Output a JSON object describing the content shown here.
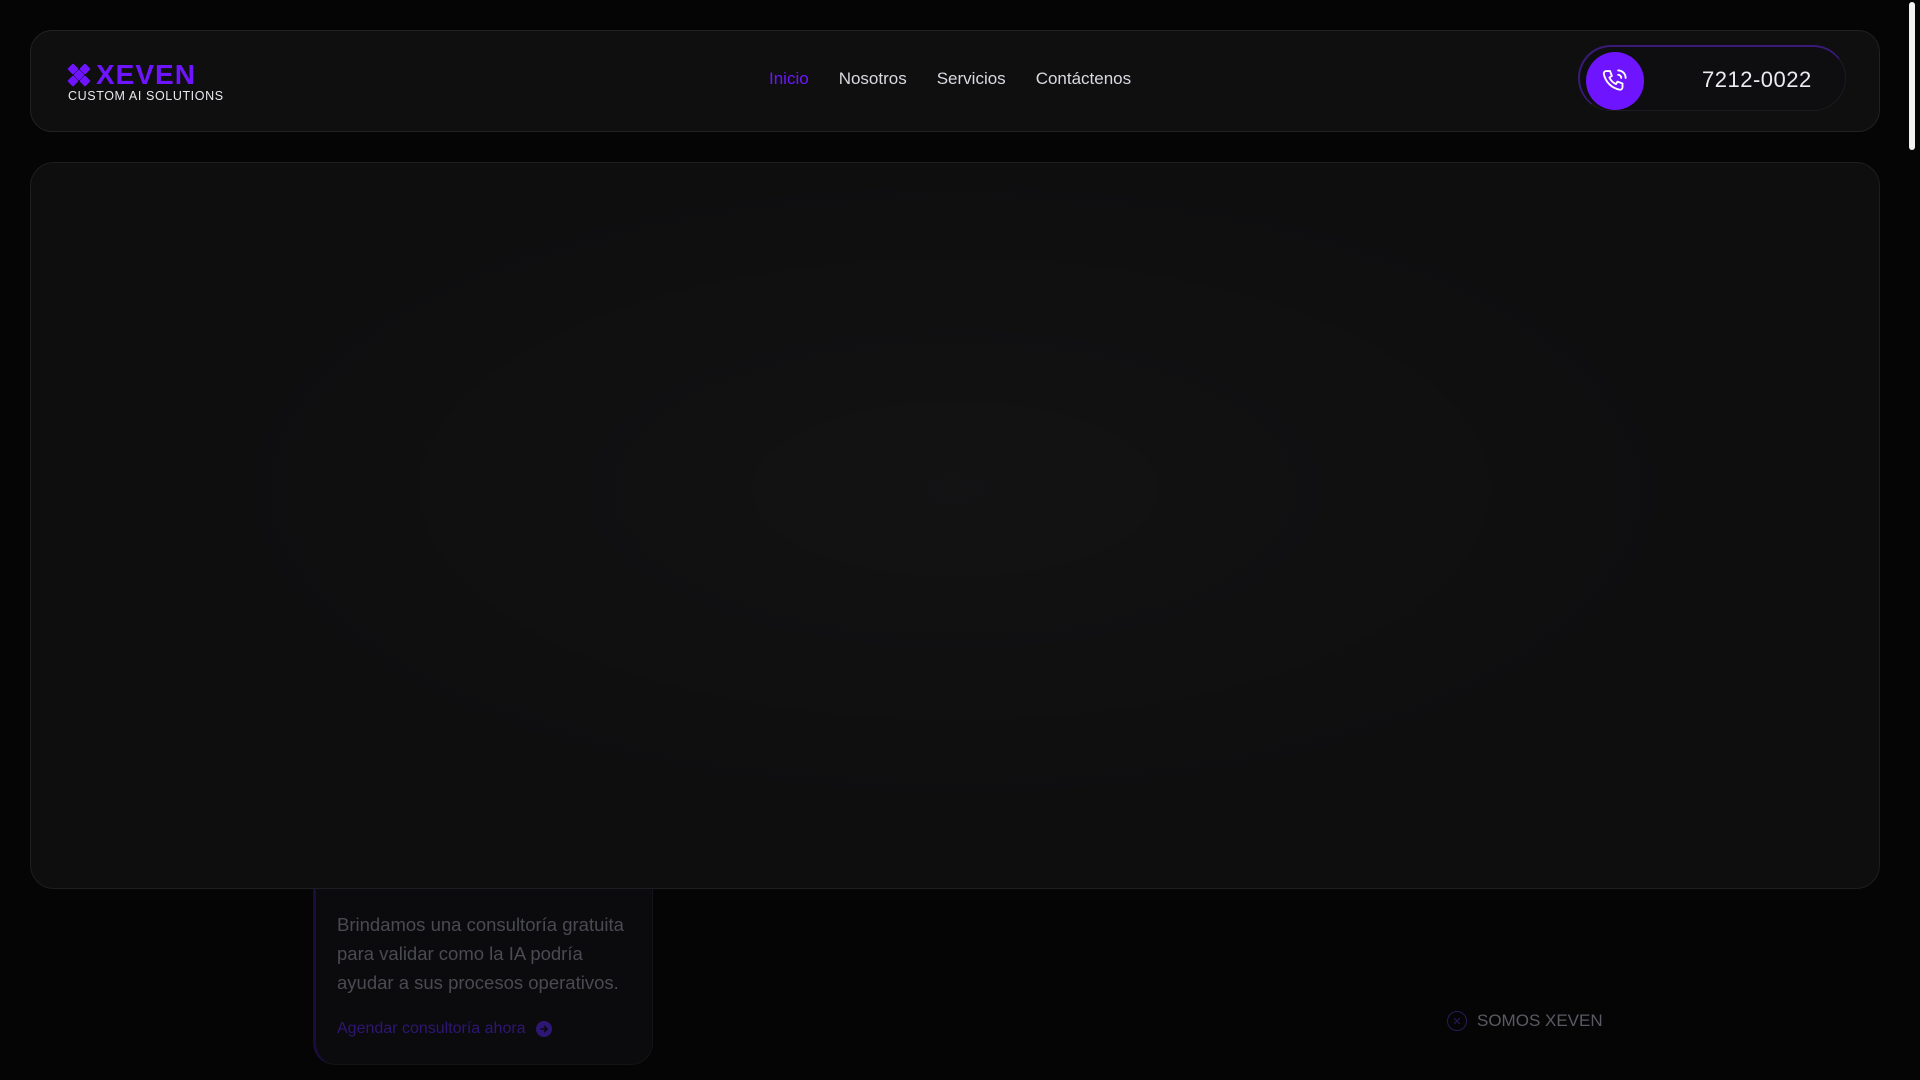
{
  "logo": {
    "word": "XEVEN",
    "tagline": "CUSTOM AI SOLUTIONS",
    "accent": "#6f14ff"
  },
  "nav": {
    "items": [
      {
        "label": "Inicio",
        "active": true
      },
      {
        "label": "Nosotros",
        "active": false
      },
      {
        "label": "Servicios",
        "active": false
      },
      {
        "label": "Contáctenos",
        "active": false
      }
    ]
  },
  "phone": {
    "icon": "phone-icon",
    "number": "7212-0022"
  },
  "consult": {
    "text": "Brindamos una consultoría gratuita para validar como la IA podría ayudar a sus procesos operativos.",
    "link_label": "Agendar consultoría ahora",
    "link_icon": "arrow-right-icon"
  },
  "somos": {
    "label": "SOMOS XEVEN",
    "icon": "xeven-mark-icon"
  }
}
